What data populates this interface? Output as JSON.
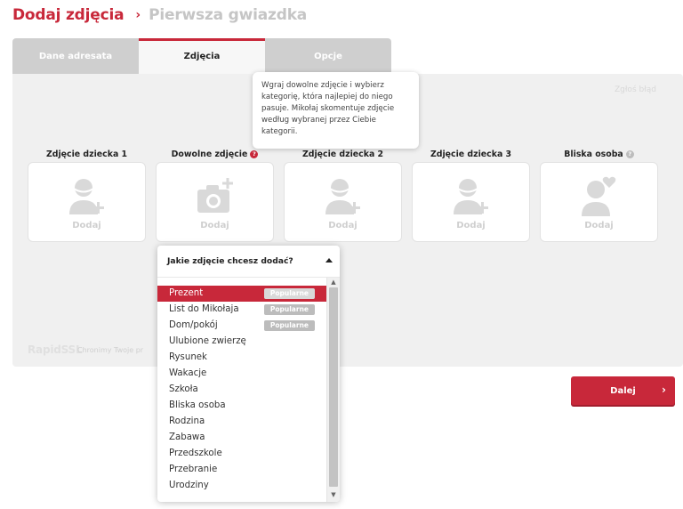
{
  "header": {
    "title": "Dodaj zdjęcia",
    "separator": "›",
    "subtitle": "Pierwsza gwiazdka"
  },
  "tabs": [
    {
      "label": "Dane adresata",
      "active": false
    },
    {
      "label": "Zdjęcia",
      "active": true
    },
    {
      "label": "Opcje",
      "active": false
    }
  ],
  "report_link": "Zgłoś błąd",
  "tooltip": "Wgraj dowolne zdjęcie i wybierz kategorię, która najlepiej do niego pasuje. Mikołaj skomentuje zdjęcie według wybranej przez Ciebie kategorii.",
  "slots": [
    {
      "label": "Zdjęcie dziecka 1",
      "add": "Dodaj",
      "icon": "child-add-icon"
    },
    {
      "label": "Dowolne zdjęcie",
      "add": "Dodaj",
      "icon": "camera-add-icon",
      "badge": "?"
    },
    {
      "label": "Zdjęcie dziecka 2",
      "add": "Dodaj",
      "icon": "child-add-icon"
    },
    {
      "label": "Zdjęcie dziecka 3",
      "add": "Dodaj",
      "icon": "child-add-icon"
    },
    {
      "label": "Bliska osoba",
      "add": "Dodaj",
      "icon": "heart-person-icon",
      "badge": "?"
    }
  ],
  "ssl": {
    "logo": "RapidSSL",
    "text": "Chronimy Twoje pr"
  },
  "next_button": {
    "label": "Dalej",
    "arrow": "›"
  },
  "dropdown": {
    "title": "Jakie zdjęcie chcesz dodać?",
    "badge_label": "Popularne",
    "items": [
      {
        "label": "Prezent",
        "popular": true,
        "selected": true
      },
      {
        "label": "List do Mikołaja",
        "popular": true
      },
      {
        "label": "Dom/pokój",
        "popular": true
      },
      {
        "label": "Ulubione zwierzę"
      },
      {
        "label": "Rysunek"
      },
      {
        "label": "Wakacje"
      },
      {
        "label": "Szkoła"
      },
      {
        "label": "Bliska osoba"
      },
      {
        "label": "Rodzina"
      },
      {
        "label": "Zabawa"
      },
      {
        "label": "Przedszkole"
      },
      {
        "label": "Przebranie"
      },
      {
        "label": "Urodziny"
      }
    ]
  },
  "colors": {
    "accent": "#c8283a",
    "panel": "#f0f0f0",
    "tab_inactive": "#cfcfcf"
  }
}
